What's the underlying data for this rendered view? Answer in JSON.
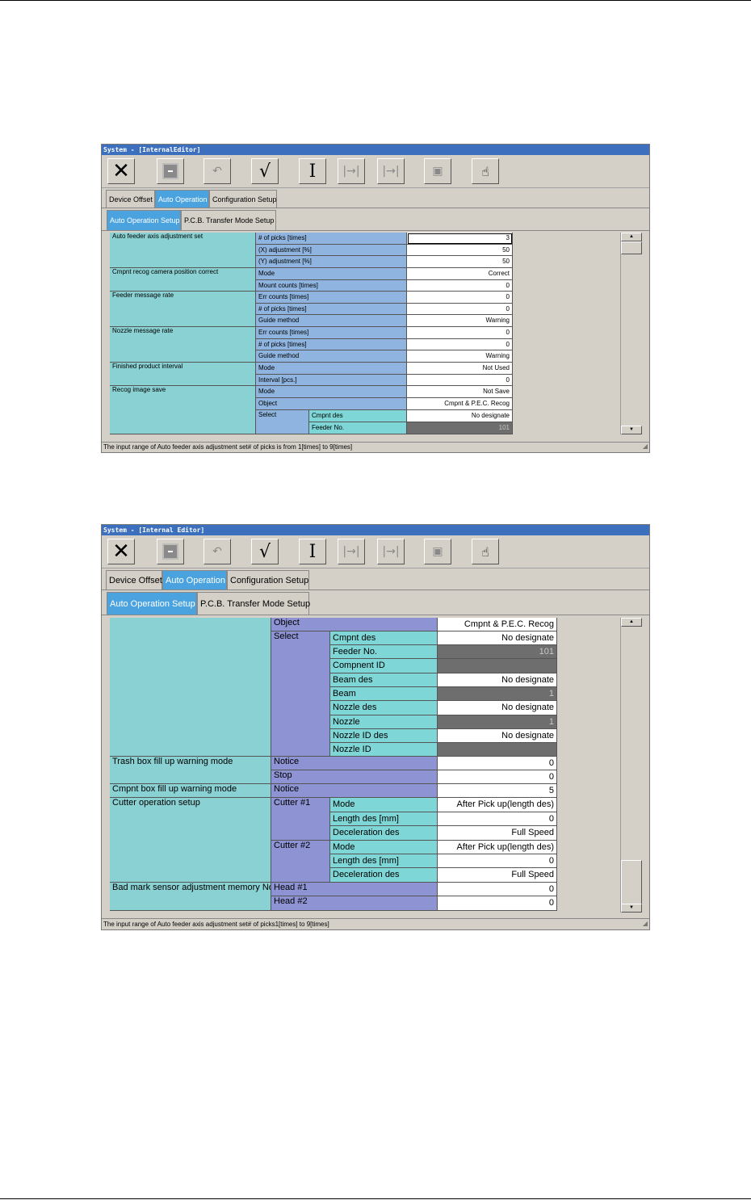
{
  "screen1": {
    "title": "System - [InternalEditor]",
    "toolbar": {
      "close": "✕",
      "stop": "",
      "undo": "↶",
      "check": "√",
      "cursor": "I",
      "step1": "|→|",
      "step2": "|→|",
      "run": "▣",
      "hand": "☝"
    },
    "tabs_main": [
      "Device Offset",
      "Auto Operation",
      "Configuration Setup"
    ],
    "tabs_sub": [
      "Auto Operation Setup",
      "P.C.B. Transfer Mode Setup"
    ],
    "groups": [
      "Auto feeder axis adjustment set",
      "Cmpnt recog camera position correct",
      "Feeder message rate",
      "Nozzle message rate",
      "Finished product interval",
      "Recog image save"
    ],
    "labels": [
      "# of picks [times]",
      "(X) adjustment [%]",
      "(Y) adjustment [%]",
      "Mode",
      "Mount counts [times]",
      "Err counts [times]",
      "# of picks [times]",
      "Guide method",
      "Err counts [times]",
      "# of picks [times]",
      "Guide method",
      "Mode",
      "Interval [pcs.]",
      "Mode",
      "Object",
      "Select",
      "Cmpnt des",
      "Feeder No."
    ],
    "values": [
      "3",
      "50",
      "50",
      "Correct",
      "0",
      "0",
      "0",
      "Warning",
      "0",
      "0",
      "Warning",
      "Not Used",
      "0",
      "Not Save",
      "Cmpnt & P.E.C. Recog",
      "No designate",
      "101"
    ],
    "status": "The input range of Auto feeder axis adjustment set# of picks is from  1[times]  to  9[times]"
  },
  "screen2": {
    "title": "System - [Internal Editor]",
    "toolbar": {
      "close": "✕",
      "stop": "",
      "undo": "↶",
      "check": "√",
      "cursor": "I",
      "step1": "|→|",
      "step2": "|→|",
      "run": "▣",
      "hand": "☝"
    },
    "tabs_main": [
      "Device Offset",
      "Auto Operation",
      "Configuration Setup"
    ],
    "tabs_sub": [
      "Auto Operation Setup",
      "P.C.B. Transfer Mode Setup"
    ],
    "groups": [
      "Trash box fill up warning mode",
      "Cmpnt box fill up warning mode",
      "Cutter operation setup",
      "Bad mark sensor adjustment memory No"
    ],
    "labels": [
      "Object",
      "Select",
      "Cmpnt des",
      "Feeder No.",
      "Compnent ID",
      "Beam des",
      "Beam",
      "Nozzle des",
      "Nozzle",
      "Nozzle ID des",
      "Nozzle ID",
      "Notice",
      "Stop",
      "Notice",
      "Cutter #1",
      "Mode",
      "Length des [mm]",
      "Deceleration des",
      "Cutter #2",
      "Mode",
      "Length des [mm]",
      "Deceleration des",
      "Head #1",
      "Head #2"
    ],
    "values": [
      "Cmpnt & P.E.C. Recog",
      "No designate",
      "101",
      "",
      "No designate",
      "1",
      "No designate",
      "1",
      "No designate",
      "",
      "0",
      "0",
      "5",
      "After Pick up(length des)",
      "0",
      "Full Speed",
      "After Pick up(length des)",
      "0",
      "Full Speed",
      "0",
      "0"
    ],
    "status": "The input range of Auto feeder axis adjustment set# of picks1[times]  to  9[times]"
  }
}
